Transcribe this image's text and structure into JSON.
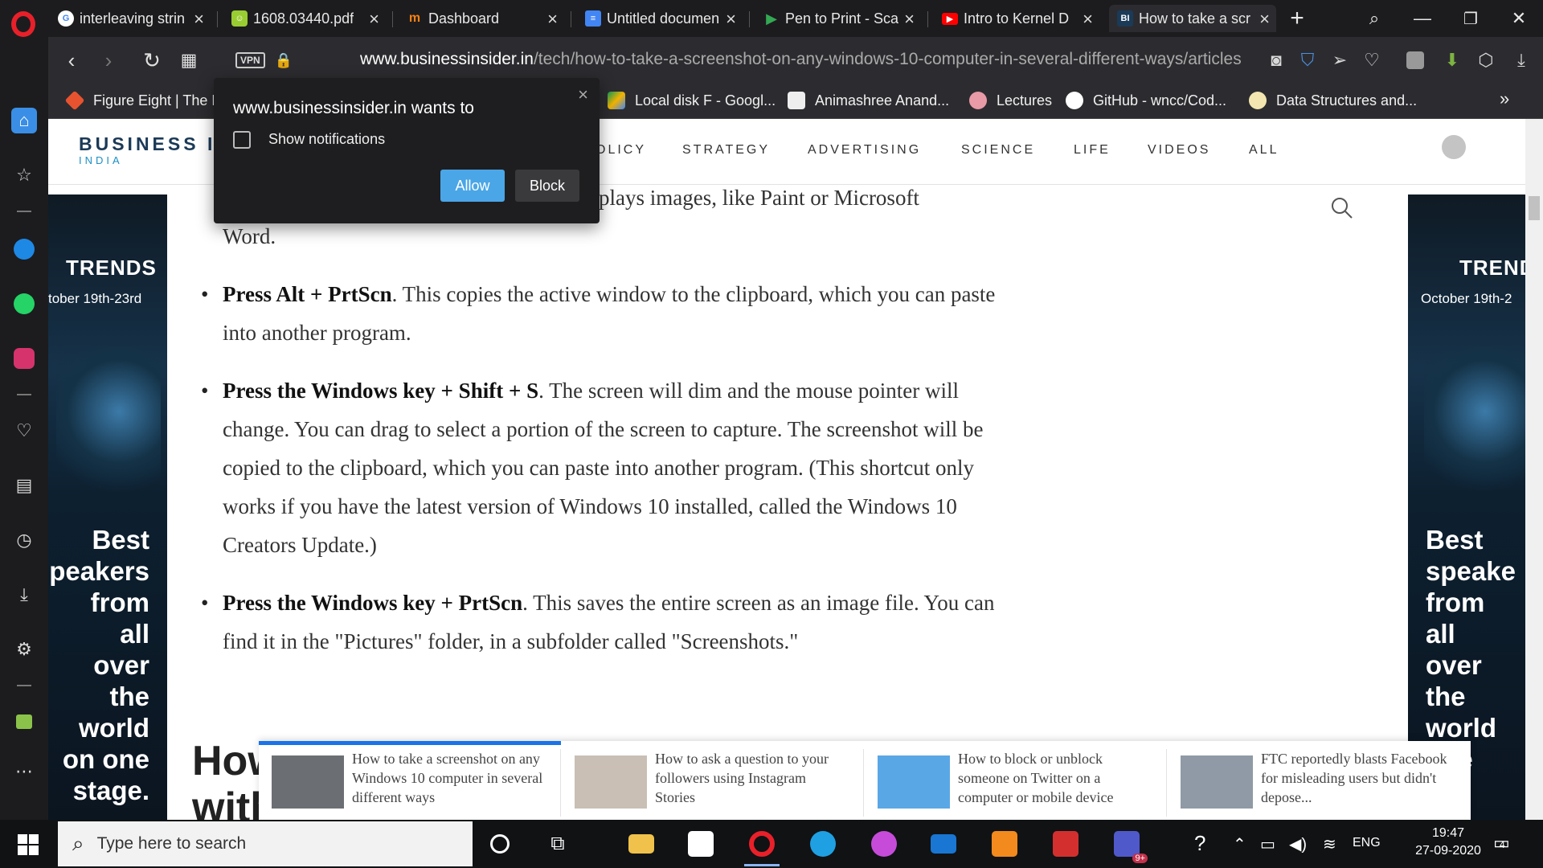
{
  "browser": {
    "tabs": [
      {
        "title": "interleaving strin",
        "favicon": "google-icon",
        "color": "#ffffff"
      },
      {
        "title": "1608.03440.pdf",
        "favicon": "smiley-icon",
        "color": "#9acd32"
      },
      {
        "title": "Dashboard",
        "favicon": "moodle-icon",
        "color": "#f98012"
      },
      {
        "title": "Untitled documen",
        "favicon": "google-docs-icon",
        "color": "#4285f4"
      },
      {
        "title": "Pen to Print - Sca",
        "favicon": "play-store-icon",
        "color": "#34a853"
      },
      {
        "title": "Intro to Kernel D",
        "favicon": "youtube-icon",
        "color": "#ff0000"
      },
      {
        "title": "How to take a scr",
        "favicon": "business-insider-icon",
        "color": "#1b3a57",
        "favicon_text": "BI",
        "active": true
      }
    ],
    "url_host": "www.businessinsider.in",
    "url_path": "/tech/how-to-take-a-screenshot-on-any-windows-10-computer-in-several-different-ways/articles",
    "vpn_label": "VPN",
    "bookmarks": [
      {
        "label": "Figure Eight | The E",
        "icon": "figure-eight-icon",
        "color": "#e8532f"
      },
      {
        "label": "Local disk F - Googl...",
        "icon": "google-drive-icon",
        "color": "#f4b400"
      },
      {
        "label": "Animashree Anand...",
        "icon": "document-icon",
        "color": "#eeeeee"
      },
      {
        "label": "Lectures",
        "icon": "lectures-icon",
        "color": "#e89aa6"
      },
      {
        "label": "GitHub - wncc/Cod...",
        "icon": "github-icon",
        "color": "#ffffff"
      },
      {
        "label": "Data Structures and...",
        "icon": "bulb-icon",
        "color": "#f3e6b0"
      }
    ],
    "more_bookmarks": "»"
  },
  "notification": {
    "title": "www.businessinsider.in wants to",
    "message": "Show notifications",
    "allow": "Allow",
    "block": "Block",
    "close": "×"
  },
  "site": {
    "brand": "BUSINESS IN",
    "brand_sub": "INDIA",
    "nav": [
      "OLICY",
      "STRATEGY",
      "ADVERTISING",
      "SCIENCE",
      "LIFE",
      "VIDEOS",
      "ALL"
    ]
  },
  "article": {
    "intro_tail": "plays images, like Paint or Microsoft",
    "intro_tail2": "Word.",
    "bullets": [
      {
        "bold": "Press Alt + PrtScn",
        "rest": ". This copies the active window to the clipboard, which you can paste into another program."
      },
      {
        "bold": "Press the Windows key + Shift + S",
        "rest": ". The screen will dim and the mouse pointer will change. You can drag to select a portion of the screen to capture. The screenshot will be copied to the clipboard, which you can paste into another program. (This shortcut only works if you have the latest version of Windows 10 installed, called the Windows 10 Creators Update.)"
      },
      {
        "bold": "Press the Windows key + PrtScn",
        "rest": ". This saves the entire screen as an image file. You can find it in the \"Pictures\" folder, in a subfolder called \"Screenshots.\""
      }
    ],
    "next_heading_line1": "How",
    "next_heading_line2": "with"
  },
  "ads": {
    "left": {
      "trends": "TRENDS",
      "date": "tober 19th-23rd",
      "best": "Best\npeakers\nfrom\nall\nover\nthe\nworld\non one\nstage."
    },
    "right": {
      "trends": "TREND",
      "date": "October 19th-2",
      "best": "Best\nspeake\nfrom\nall\nover\nthe\nworld\none\nge."
    }
  },
  "related": [
    {
      "title": "How to take a screenshot on any Windows 10 computer in several different ways"
    },
    {
      "title": "How to ask a question to your followers using Instagram Stories"
    },
    {
      "title": "How to block or unblock someone on Twitter on a computer or mobile device"
    },
    {
      "title": "FTC reportedly blasts Facebook for misleading users but didn't depose..."
    }
  ],
  "taskbar": {
    "search_placeholder": "Type here to search",
    "apps": [
      {
        "name": "file-explorer-icon",
        "color": "#f0c14b"
      },
      {
        "name": "microsoft-store-icon",
        "color": "#ffffff"
      },
      {
        "name": "opera-icon",
        "color": "#e8202a",
        "active": true
      },
      {
        "name": "edge-icon",
        "color": "#1fa0e3"
      },
      {
        "name": "photo-app-icon",
        "color": "#c64bd8"
      },
      {
        "name": "mail-icon",
        "color": "#1976d2"
      },
      {
        "name": "sublime-text-icon",
        "color": "#f38a1d"
      },
      {
        "name": "acrobat-icon",
        "color": "#d32f2f"
      },
      {
        "name": "teams-icon",
        "color": "#5059c9"
      }
    ],
    "teams_badge": "9+",
    "language": "ENG",
    "time": "19:47",
    "date": "27-09-2020",
    "notification_count": "4"
  }
}
